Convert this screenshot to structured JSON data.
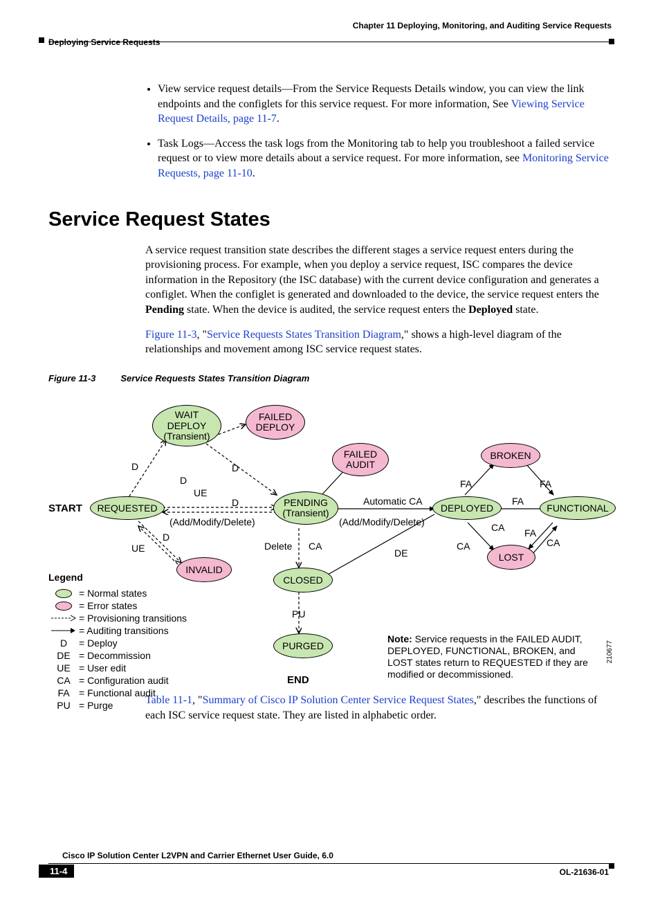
{
  "header": {
    "chapter": "Chapter 11    Deploying, Monitoring, and Auditing Service Requests",
    "section": "Deploying Service Requests"
  },
  "bullets": {
    "b1_a": "View service request details—From the Service Requests Details window, you can view the link endpoints and the configlets for this service request. For more information, See ",
    "b1_link": "Viewing Service Request Details, page 11-7",
    "b1_b": ".",
    "b2_a": "Task Logs—Access the task logs from the Monitoring tab to help you troubleshoot a failed service request or to view more details about a service request. For more information, see ",
    "b2_link": "Monitoring Service Requests, page 11-10",
    "b2_b": "."
  },
  "heading": "Service Request States",
  "para1_a": "A service request transition state describes the different stages a service request enters during the provisioning process. For example, when you deploy a service request, ISC compares the device information in the Repository (the ISC database) with the current device configuration and generates a configlet. When the configlet is generated and downloaded to the device, the service request enters the ",
  "para1_pending": "Pending",
  "para1_b": " state. When the device is audited, the service request enters the ",
  "para1_deployed": "Deployed",
  "para1_c": " state.",
  "para2_link1": "Figure 11-3",
  "para2_mid": ", \"",
  "para2_link2": "Service Requests States Transition Diagram",
  "para2_end": ",\" shows a high-level diagram of the relationships and movement among ISC service request states.",
  "figcap": {
    "num": "Figure 11-3",
    "title": "Service Requests States Transition Diagram"
  },
  "nodes": {
    "wait": "WAIT\nDEPLOY\n(Transient)",
    "failedDeploy": "FAILED\nDEPLOY",
    "failedAudit": "FAILED\nAUDIT",
    "broken": "BROKEN",
    "requested": "REQUESTED",
    "pending": "PENDING\n(Transient)",
    "deployed": "DEPLOYED",
    "functional": "FUNCTIONAL",
    "invalid": "INVALID",
    "closed": "CLOSED",
    "lost": "LOST",
    "purged": "PURGED",
    "start": "START",
    "end": "END"
  },
  "edgeLabels": {
    "d": "D",
    "ue": "UE",
    "fa": "FA",
    "ca": "CA",
    "de": "DE",
    "pu": "PU",
    "autoCA": "Automatic CA",
    "amd1": "(Add/Modify/Delete)",
    "amd2": "(Add/Modify/Delete)",
    "delete": "Delete"
  },
  "legend": {
    "title": "Legend",
    "rows": [
      {
        "sym": "green",
        "txt": "=  Normal states"
      },
      {
        "sym": "pink",
        "txt": "=  Error states"
      },
      {
        "sym": "dash",
        "txt": "=  Provisioning transitions"
      },
      {
        "sym": "solid",
        "txt": "=  Auditing transitions"
      },
      {
        "sym": "D",
        "txt": "=  Deploy"
      },
      {
        "sym": "DE",
        "txt": "=  Decommission"
      },
      {
        "sym": "UE",
        "txt": "=  User edit"
      },
      {
        "sym": "CA",
        "txt": "=  Configuration audit"
      },
      {
        "sym": "FA",
        "txt": "=  Functional audit"
      },
      {
        "sym": "PU",
        "txt": "=  Purge"
      }
    ]
  },
  "note_bold": "Note:",
  "note": " Service requests in the FAILED AUDIT, DEPLOYED, FUNCTIONAL, BROKEN, and LOST states return to REQUESTED if they are modified or decommissioned.",
  "sidetag": "210677",
  "para3_link1": "Table 11-1",
  "para3_mid": ", \"",
  "para3_link2": "Summary of Cisco IP Solution Center Service Request States",
  "para3_end": ",\" describes the functions of each ISC service request state. They are listed in alphabetic order.",
  "footer": {
    "title": "Cisco IP Solution Center L2VPN and Carrier Ethernet User Guide, 6.0",
    "page": "11-4",
    "docid": "OL-21636-01"
  }
}
